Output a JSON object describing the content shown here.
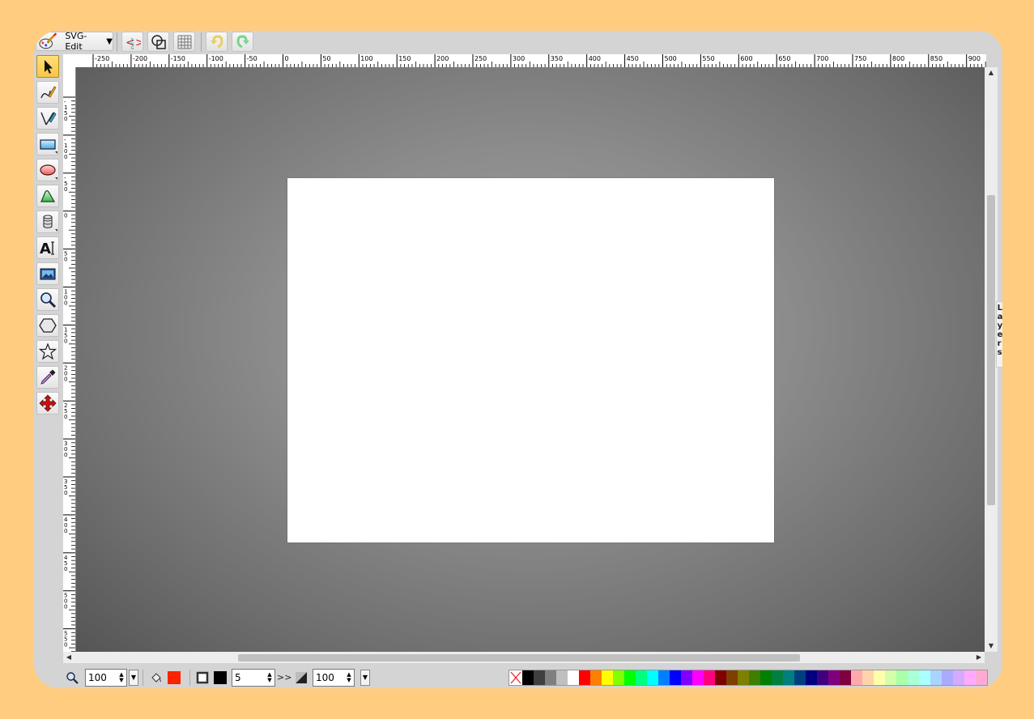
{
  "app": {
    "name": "SVG-Edit"
  },
  "topbar": {
    "logo_label": "SVG-Edit",
    "buttons": [
      "source-editor",
      "wireframe",
      "grid",
      "undo",
      "redo"
    ]
  },
  "tools": [
    {
      "name": "select-tool",
      "icon": "pointer-arrow-icon",
      "active": true
    },
    {
      "name": "pencil-tool",
      "icon": "pencil-icon"
    },
    {
      "name": "path-tool",
      "icon": "pen-icon"
    },
    {
      "name": "rectangle-tool",
      "icon": "rectangle-icon",
      "flyout": true
    },
    {
      "name": "ellipse-tool",
      "icon": "ellipse-icon",
      "flyout": true
    },
    {
      "name": "shape-library-tool",
      "icon": "shape-library-icon"
    },
    {
      "name": "database-tool",
      "icon": "database-icon",
      "flyout": true
    },
    {
      "name": "text-tool",
      "icon": "text-icon"
    },
    {
      "name": "image-tool",
      "icon": "image-icon"
    },
    {
      "name": "zoom-tool",
      "icon": "magnifier-icon"
    },
    {
      "name": "polygon-tool",
      "icon": "hexagon-icon"
    },
    {
      "name": "star-tool",
      "icon": "star-icon"
    },
    {
      "name": "eyedropper-tool",
      "icon": "eyedropper-icon"
    },
    {
      "name": "panning-tool",
      "icon": "move-arrows-icon"
    }
  ],
  "ruler_x_labels": [
    "-250",
    "-200",
    "-150",
    "-100",
    "-50",
    "0",
    "50",
    "100",
    "150",
    "200",
    "250",
    "300",
    "350",
    "400",
    "450",
    "500",
    "550",
    "600",
    "650",
    "700",
    "750",
    "800",
    "850",
    "900"
  ],
  "ruler_y_labels": [
    "-150",
    "-100",
    "-50",
    "0",
    "50",
    "100",
    "150",
    "200",
    "250",
    "300",
    "350",
    "400",
    "450",
    "500",
    "550",
    "600"
  ],
  "layers_tab": {
    "label": "Layers"
  },
  "bottombar": {
    "zoom_value": "100",
    "stroke_width": "5",
    "more_label": ">>",
    "opacity_value": "100",
    "fill_color": "#FF2200",
    "stroke_color": "#000000"
  },
  "palette": [
    "#000000",
    "#3f3f3f",
    "#7f7f7f",
    "#bfbfbf",
    "#ffffff",
    "#ff0000",
    "#ff7f00",
    "#ffff00",
    "#7fff00",
    "#00ff00",
    "#00ff7f",
    "#00ffff",
    "#007fff",
    "#0000ff",
    "#7f00ff",
    "#ff00ff",
    "#ff007f",
    "#7f0000",
    "#7f3f00",
    "#7f7f00",
    "#3f7f00",
    "#007f00",
    "#007f3f",
    "#007f7f",
    "#003f7f",
    "#00007f",
    "#3f007f",
    "#7f007f",
    "#7f003f",
    "#ffaaaa",
    "#ffd4aa",
    "#ffffaa",
    "#d4ffaa",
    "#aaffaa",
    "#aaffd4",
    "#aaffff",
    "#aad4ff",
    "#aaaaff",
    "#d4aaff",
    "#ffaaff",
    "#ffaad4"
  ]
}
